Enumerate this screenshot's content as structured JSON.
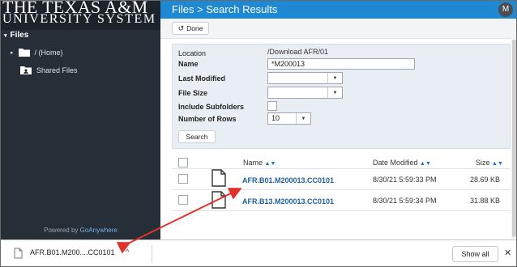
{
  "brand": {
    "line1": "THE TEXAS A&M",
    "line2": "UNIVERSITY SYSTEM"
  },
  "sidebar": {
    "header": "Files",
    "items": [
      {
        "label": "/ (Home)",
        "icon": "folder-icon"
      },
      {
        "label": "Shared Files",
        "icon": "shared-folder-icon"
      }
    ],
    "powered_prefix": "Powered by ",
    "powered_link": "GoAnywhere"
  },
  "titlebar": {
    "title": "Files > Search Results",
    "avatar": "M"
  },
  "toolbar": {
    "done_label": "Done"
  },
  "form": {
    "location_label": "Location",
    "location_value": "/Download AFR/01",
    "name_label": "Name",
    "name_value": "*M200013",
    "last_modified_label": "Last Modified",
    "last_modified_value": "",
    "file_size_label": "File Size",
    "file_size_value": "",
    "include_subfolders_label": "Include Subfolders",
    "include_subfolders_checked": false,
    "rows_label": "Number of Rows",
    "rows_value": "10",
    "search_label": "Search"
  },
  "table": {
    "columns": [
      "Name",
      "Date Modified",
      "Size"
    ],
    "rows": [
      {
        "name": "AFR.B01.M200013.CC0101",
        "date": "8/30/21 5:59:33 PM",
        "size": "28.69 KB"
      },
      {
        "name": "AFR.B13.M200013.CC0101",
        "date": "8/30/21 5:59:34 PM",
        "size": "31.88 KB"
      }
    ]
  },
  "download_bar": {
    "file_label": "AFR.B01.M200....CC0101",
    "show_all_label": "Show all",
    "close_label": "✕"
  },
  "colors": {
    "sidebar_bg": "#262e38",
    "titlebar_bg": "#1e88d2",
    "link": "#1f5f9e",
    "annotation_arrow": "#e0312a"
  }
}
